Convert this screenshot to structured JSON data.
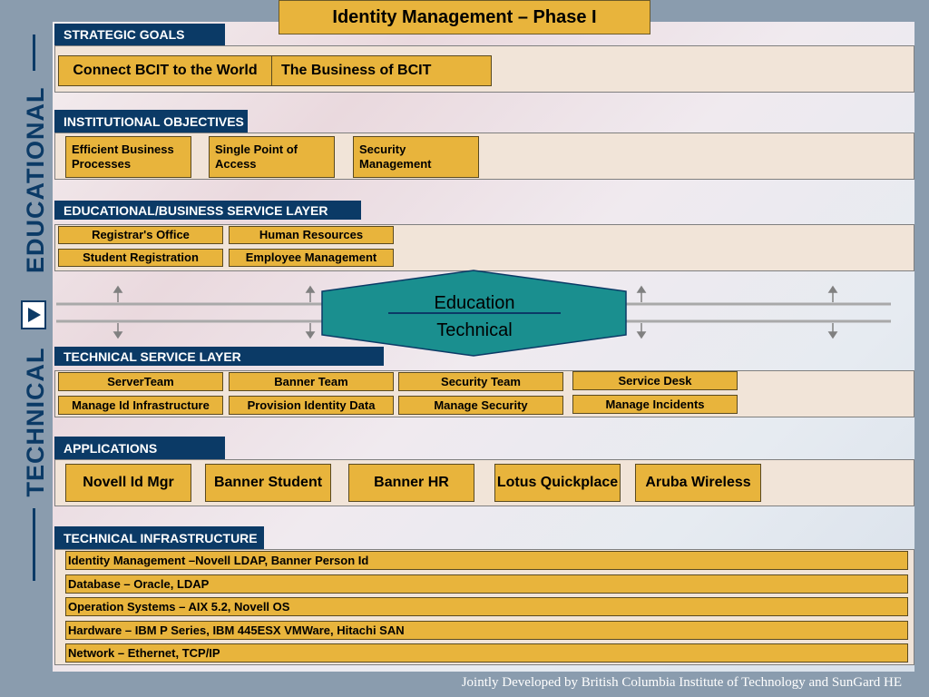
{
  "title": "Identity Management – Phase I",
  "side": {
    "educational": "EDUCATIONAL",
    "technical": "TECHNICAL"
  },
  "strategic": {
    "header": "STRATEGIC GOALS",
    "items": [
      "Connect BCIT to the World",
      "The Business of BCIT"
    ]
  },
  "institutional": {
    "header": "INSTITUTIONAL OBJECTIVES",
    "items": [
      "Efficient Business Processes",
      "Single Point of Access",
      "Security Management"
    ]
  },
  "edu_layer": {
    "header": "EDUCATIONAL/BUSINESS SERVICE LAYER",
    "items": [
      "Registrar's Office",
      "Human Resources",
      "Student Registration",
      "Employee Management"
    ]
  },
  "bridge": {
    "top": "Education",
    "bottom": "Technical"
  },
  "tech_layer": {
    "header": "TECHNICAL SERVICE LAYER",
    "items": [
      "ServerTeam",
      "Banner Team",
      "Security Team",
      "Service Desk",
      "Manage Id Infrastructure",
      "Provision Identity Data",
      "Manage Security",
      "Manage Incidents"
    ]
  },
  "applications": {
    "header": "APPLICATIONS",
    "items": [
      "Novell Id Mgr",
      "Banner Student",
      "Banner HR",
      "Lotus Quickplace",
      "Aruba Wireless"
    ]
  },
  "infrastructure": {
    "header": "TECHNICAL INFRASTRUCTURE",
    "items": [
      "Identity Management –Novell LDAP, Banner Person Id",
      "Database – Oracle, LDAP",
      "Operation Systems – AIX 5.2, Novell OS",
      "Hardware – IBM P Series, IBM 445ESX VMWare, Hitachi SAN",
      "Network – Ethernet, TCP/IP"
    ]
  },
  "footer": "Jointly Developed by British Columbia Institute of Technology and SunGard HE",
  "colors": {
    "navy": "#0b3a66",
    "gold": "#e8b43c",
    "panel": "#f1e4d8",
    "teal": "#1a8f8f",
    "slate": "#8a9cae"
  }
}
